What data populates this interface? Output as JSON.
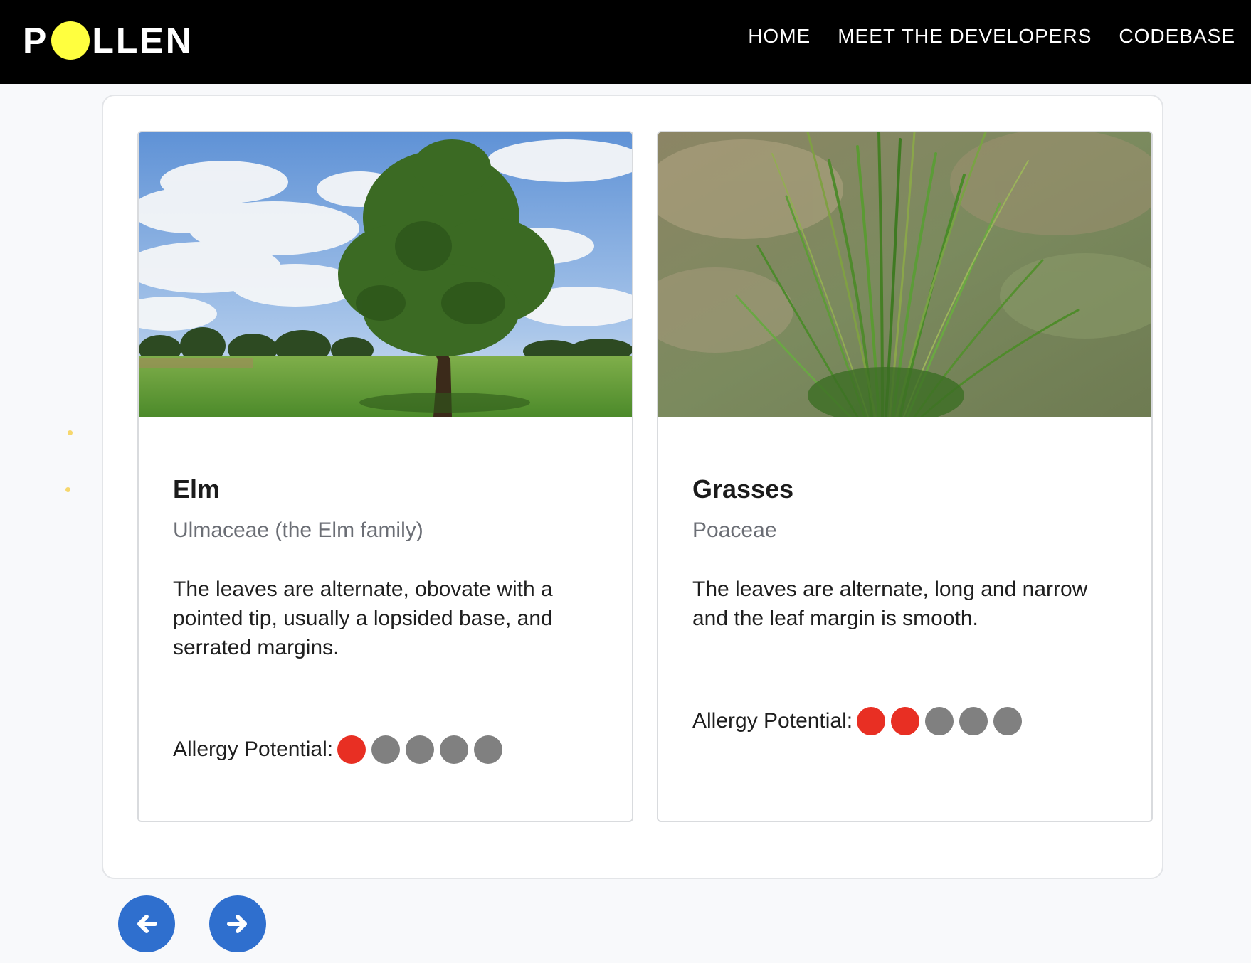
{
  "brand": {
    "logo_prefix": "P",
    "logo_suffix": "LLEN",
    "dot_color": "#ffff3f"
  },
  "nav": {
    "items": [
      {
        "label": "HOME"
      },
      {
        "label": "MEET THE DEVELOPERS"
      },
      {
        "label": "CODEBASE"
      }
    ]
  },
  "cards": [
    {
      "title": "Elm",
      "family": "Ulmaceae (the Elm family)",
      "description": "The leaves are alternate, obovate with a pointed tip, usually a lopsided base, and serrated margins.",
      "allergy_label": "Allergy Potential:",
      "allergy_level": 1,
      "allergy_max": 5,
      "image_subject": "elm-tree-in-meadow"
    },
    {
      "title": "Grasses",
      "family": "Poaceae",
      "description": "The leaves are alternate, long and narrow and the leaf margin is smooth.",
      "allergy_label": "Allergy Potential:",
      "allergy_level": 2,
      "allergy_max": 5,
      "image_subject": "grass-tuft"
    }
  ],
  "controls": {
    "prev_icon": "arrow-left-icon",
    "next_icon": "arrow-right-icon"
  },
  "colors": {
    "header_bg": "#000000",
    "accent_blue": "#2f6fce",
    "allergy_active": "#e82f23",
    "allergy_inactive": "#808080"
  }
}
